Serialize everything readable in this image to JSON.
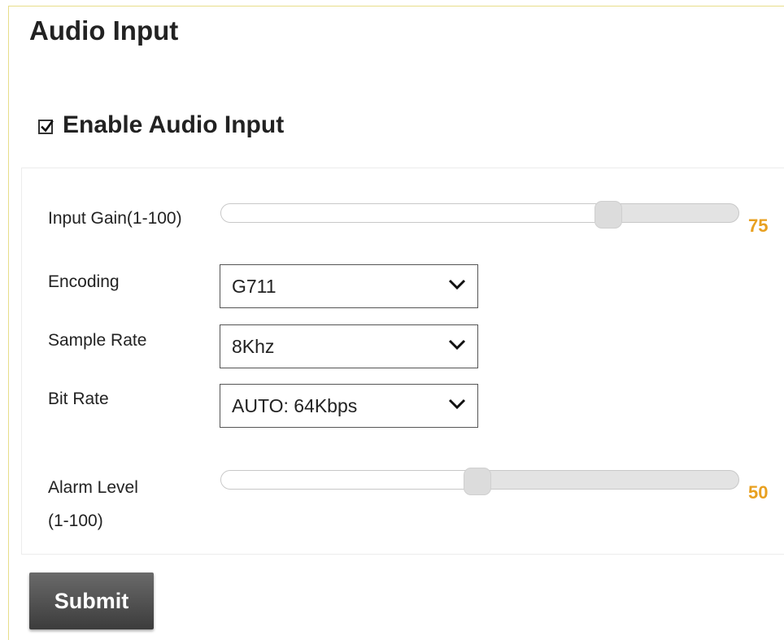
{
  "page": {
    "title": "Audio Input"
  },
  "enable_audio_input": {
    "label": "Enable Audio Input",
    "checked": true
  },
  "input_gain": {
    "label": "Input Gain(1-100)",
    "value": 75,
    "min": 1,
    "max": 100
  },
  "encoding": {
    "label": "Encoding",
    "selected": "G711"
  },
  "sample_rate": {
    "label": "Sample Rate",
    "selected": "8Khz"
  },
  "bit_rate": {
    "label": "Bit Rate",
    "selected": "AUTO: 64Kbps"
  },
  "alarm_level": {
    "label_line1": "Alarm Level",
    "label_line2": "(1-100)",
    "value": 50,
    "min": 1,
    "max": 100
  },
  "submit": {
    "label": "Submit"
  },
  "colors": {
    "value_accent": "#e8a020",
    "button_dark": "#3c3c3c",
    "frame_border": "#e8de8a"
  },
  "icons": {
    "checkbox": "checkmark-icon",
    "select_arrow": "chevron-down-icon"
  }
}
